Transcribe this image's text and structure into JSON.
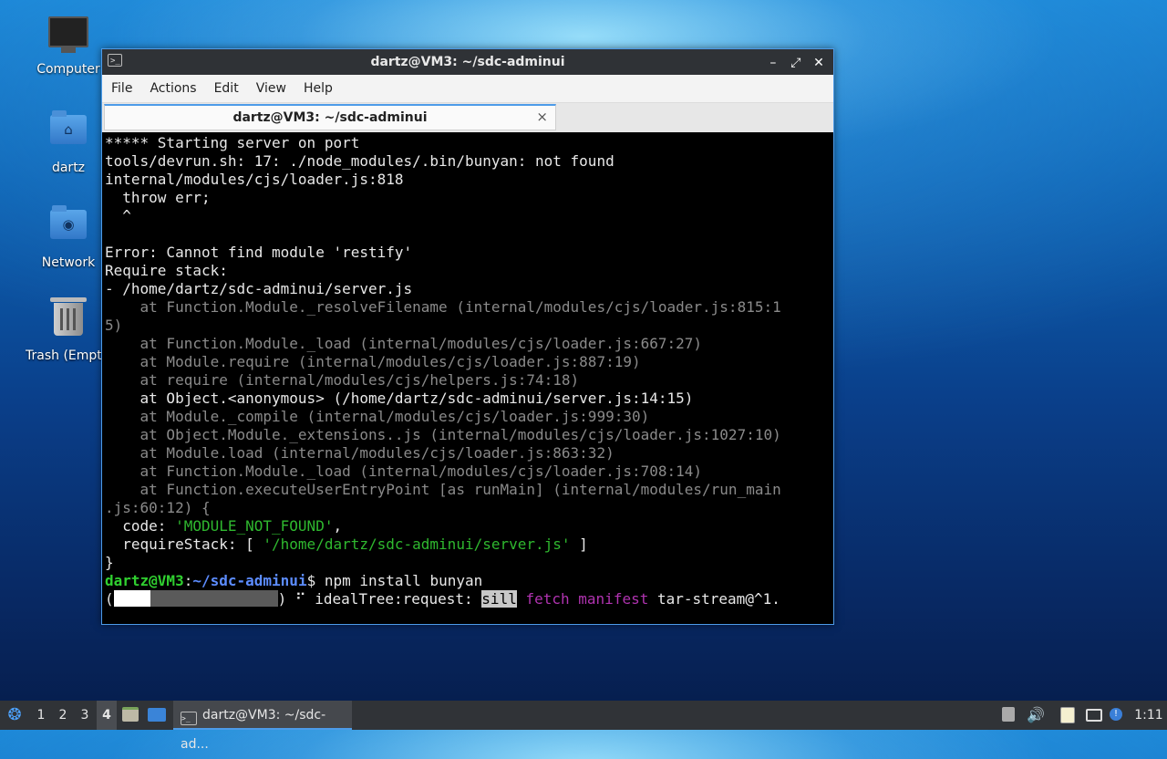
{
  "desktop": {
    "icons": [
      {
        "label": "Computer"
      },
      {
        "label": "dartz"
      },
      {
        "label": "Network"
      },
      {
        "label": "Trash (Empty)"
      }
    ]
  },
  "window": {
    "title": "dartz@VM3: ~/sdc-adminui",
    "menu": [
      "File",
      "Actions",
      "Edit",
      "View",
      "Help"
    ],
    "tab_label": "dartz@VM3: ~/sdc-adminui",
    "controls": {
      "minimize": "–",
      "maximize": "⤢",
      "close": "✕"
    }
  },
  "terminal": {
    "lines": [
      "***** Starting server on port",
      "tools/devrun.sh: 17: ./node_modules/.bin/bunyan: not found",
      "internal/modules/cjs/loader.js:818",
      "  throw err;",
      "  ^",
      "",
      "Error: Cannot find module 'restify'",
      "Require stack:",
      "- /home/dartz/sdc-adminui/server.js",
      "    at Function.Module._resolveFilename (internal/modules/cjs/loader.js:815:1",
      "5)",
      "    at Function.Module._load (internal/modules/cjs/loader.js:667:27)",
      "    at Module.require (internal/modules/cjs/loader.js:887:19)",
      "    at require (internal/modules/cjs/helpers.js:74:18)",
      "    at Object.<anonymous> (/home/dartz/sdc-adminui/server.js:14:15)",
      "    at Module._compile (internal/modules/cjs/loader.js:999:30)",
      "    at Object.Module._extensions..js (internal/modules/cjs/loader.js:1027:10)",
      "    at Module.load (internal/modules/cjs/loader.js:863:32)",
      "    at Function.Module._load (internal/modules/cjs/loader.js:708:14)",
      "    at Function.executeUserEntryPoint [as runMain] (internal/modules/run_main",
      ".js:60:12) {",
      "  code: ",
      "'MODULE_NOT_FOUND'",
      ",",
      "  requireStack: [ ",
      "'/home/dartz/sdc-adminui/server.js'",
      " ]",
      "}"
    ],
    "prompt_user": "dartz@VM3",
    "prompt_sep": ":",
    "prompt_path": "~/sdc-adminui",
    "prompt_dollar": "$ ",
    "command": "npm install bunyan",
    "progress_open": "(",
    "progress_close": ")",
    "spinner": " ⠋ ",
    "npm_stage": "idealTree:request: ",
    "npm_level": "sill",
    "npm_action": "fetch",
    "npm_detail": "manifest",
    "npm_pkg": "tar-stream@^1."
  },
  "taskbar": {
    "workspaces": [
      "1",
      "2",
      "3",
      "4"
    ],
    "active_workspace": "4",
    "task_label": "dartz@VM3: ~/sdc-ad...",
    "clock": "1:11"
  }
}
